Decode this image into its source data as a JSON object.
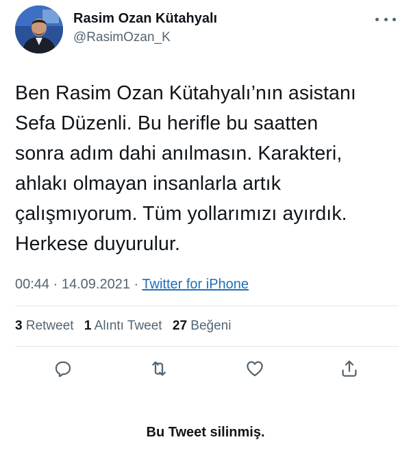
{
  "user": {
    "display_name": "Rasim Ozan Kütahyalı",
    "handle": "@RasimOzan_K",
    "avatar_icon": "profile-photo"
  },
  "tweet": {
    "text_lines": [
      "Ben Rasim Ozan Kütahyalı’nın asistanı",
      "Sefa Düzenli. Bu herifle bu saatten",
      "sonra adım dahi anılmasın. Karakteri,",
      "ahlakı olmayan insanlarla artık",
      "çalışmıyorum. Tüm yollarımızı ayırdık.",
      "Herkese duyurulur."
    ],
    "time": "00:44",
    "separator": "·",
    "date": "14.09.2021",
    "source": "Twitter for iPhone"
  },
  "stats": {
    "retweets_count": "3",
    "retweets_label": "Retweet",
    "quotes_count": "1",
    "quotes_label": "Alıntı Tweet",
    "likes_count": "27",
    "likes_label": "Beğeni"
  },
  "actions": {
    "reply_icon": "reply-icon",
    "retweet_icon": "retweet-icon",
    "like_icon": "heart-icon",
    "share_icon": "share-icon"
  },
  "notice": {
    "deleted_text": "Bu Tweet silinmiş."
  },
  "colors": {
    "text_primary": "#0f1419",
    "text_secondary": "#536471",
    "link": "#1d6fb8",
    "divider": "#e3e7ea"
  }
}
